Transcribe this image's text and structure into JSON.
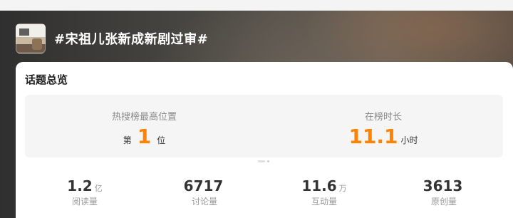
{
  "topic": {
    "title": "#宋祖儿张新成新剧过审#",
    "thumbnail_icon": "topic-thumbnail"
  },
  "overview": {
    "heading": "话题总览",
    "hot_search": {
      "label": "热搜榜最高位置",
      "prefix": "第",
      "value": "1",
      "suffix": "位"
    },
    "duration": {
      "label": "在榜时长",
      "value": "11.1",
      "suffix": "小时"
    },
    "accent_color": "#ff8200"
  },
  "metrics": [
    {
      "value": "1.2",
      "unit": "亿",
      "label": "阅读量"
    },
    {
      "value": "6717",
      "unit": "",
      "label": "讨论量"
    },
    {
      "value": "11.6",
      "unit": "万",
      "label": "互动量"
    },
    {
      "value": "3613",
      "unit": "",
      "label": "原创量"
    }
  ]
}
